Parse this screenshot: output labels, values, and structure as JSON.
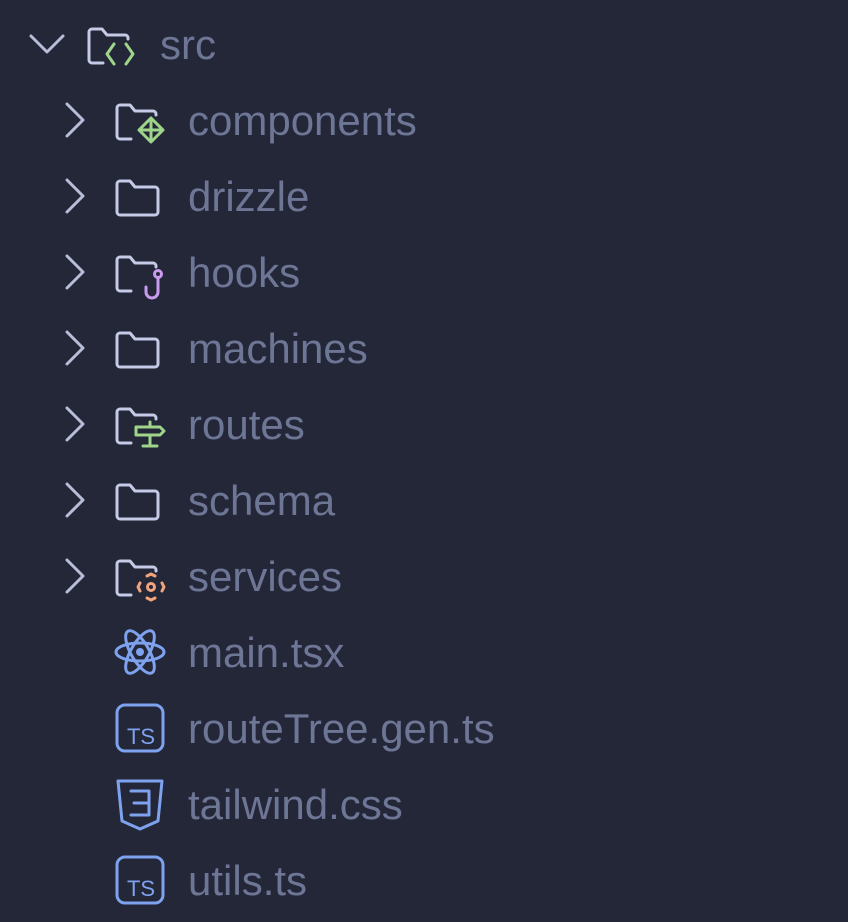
{
  "colors": {
    "background": "#242738",
    "label": "#6E7696",
    "chevron": "#B8BED8",
    "folder_outline": "#C5CAE6",
    "accent_green": "#9FD58A",
    "accent_purple": "#C99BEF",
    "accent_orange": "#F2A57C",
    "accent_blue": "#7EA2EE"
  },
  "root": {
    "name": "src",
    "expanded": true,
    "icon": "folder-source-icon"
  },
  "items": [
    {
      "name": "components",
      "kind": "folder",
      "expanded": false,
      "icon": "folder-components-icon"
    },
    {
      "name": "drizzle",
      "kind": "folder",
      "expanded": false,
      "icon": "folder-icon"
    },
    {
      "name": "hooks",
      "kind": "folder",
      "expanded": false,
      "icon": "folder-hooks-icon"
    },
    {
      "name": "machines",
      "kind": "folder",
      "expanded": false,
      "icon": "folder-icon"
    },
    {
      "name": "routes",
      "kind": "folder",
      "expanded": false,
      "icon": "folder-routes-icon"
    },
    {
      "name": "schema",
      "kind": "folder",
      "expanded": false,
      "icon": "folder-icon"
    },
    {
      "name": "services",
      "kind": "folder",
      "expanded": false,
      "icon": "folder-services-icon"
    },
    {
      "name": "main.tsx",
      "kind": "file",
      "icon": "react-file-icon"
    },
    {
      "name": "routeTree.gen.ts",
      "kind": "file",
      "icon": "typescript-file-icon"
    },
    {
      "name": "tailwind.css",
      "kind": "file",
      "icon": "css-file-icon"
    },
    {
      "name": "utils.ts",
      "kind": "file",
      "icon": "typescript-file-icon"
    }
  ]
}
